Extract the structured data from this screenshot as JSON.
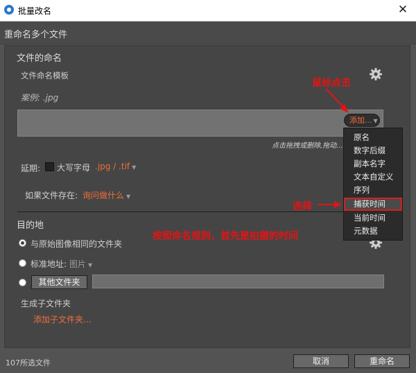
{
  "window": {
    "title": "批量改名",
    "close_symbol": "✕"
  },
  "header": {
    "text": "重命名多个文件"
  },
  "naming": {
    "section_title": "文件的命名",
    "template_label": "文件命名模板",
    "sample_text": "案例: .jpg",
    "add_button": "添加...",
    "hint": "点击拖拽或删除,拖动..."
  },
  "extension": {
    "label": "延期:",
    "uppercase_label": "大写字母",
    "value": ".jpg / .tif"
  },
  "if_exists": {
    "label": "如果文件存在:",
    "value": "询问做什么"
  },
  "destination": {
    "section_title": "目的地",
    "option_same": "与原始图像相同的文件夹",
    "option_standard": "标准地址:",
    "standard_value": "图片",
    "other_folder_button": "其他文件夹",
    "subfolder_label": "生成子文件夹",
    "add_subfolder": "添加子文件夹..."
  },
  "menu": {
    "items": [
      "原名",
      "数字后缀",
      "副本名字",
      "文本自定义",
      "序列",
      "捕获时间",
      "当前时间",
      "元数据"
    ],
    "highlighted_index": 5
  },
  "annotations": {
    "click": "鼠标点击",
    "select": "选择",
    "rule": "按照命名规则，首先是拍摄的时间"
  },
  "footer": {
    "selected_count": "107所选文件",
    "cancel_button": "取消",
    "rename_button": "重命名"
  },
  "colors": {
    "accent": "#ef6e3c",
    "annotation": "#e11515"
  }
}
